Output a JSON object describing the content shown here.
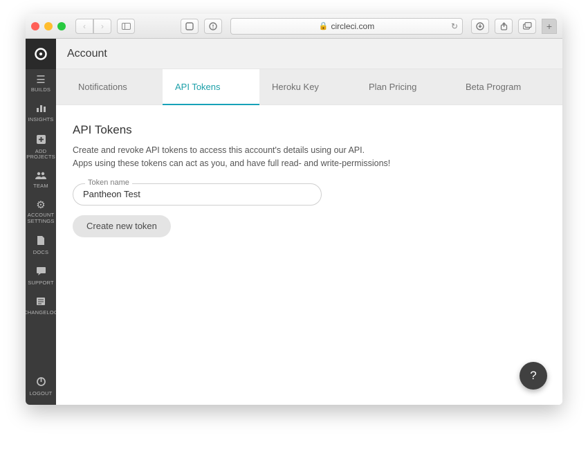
{
  "browser": {
    "url_host": "circleci.com"
  },
  "header": {
    "title": "Account"
  },
  "sidebar": {
    "items": [
      {
        "label": "BUILDS"
      },
      {
        "label": "INSIGHTS"
      },
      {
        "label": "ADD PROJECTS"
      },
      {
        "label": "TEAM"
      },
      {
        "label": "ACCOUNT SETTINGS"
      },
      {
        "label": "DOCS"
      },
      {
        "label": "SUPPORT"
      },
      {
        "label": "CHANGELOG"
      }
    ],
    "logout_label": "LOGOUT"
  },
  "tabs": [
    {
      "label": "Notifications"
    },
    {
      "label": "API Tokens",
      "active": true
    },
    {
      "label": "Heroku Key"
    },
    {
      "label": "Plan Pricing"
    },
    {
      "label": "Beta Program"
    }
  ],
  "page": {
    "heading": "API Tokens",
    "desc_line1": "Create and revoke API tokens to access this account's details using our API.",
    "desc_line2": "Apps using these tokens can act as you, and have full read- and write-permissions!",
    "token_label": "Token name",
    "token_value": "Pantheon Test",
    "create_label": "Create new token"
  },
  "help_label": "?"
}
